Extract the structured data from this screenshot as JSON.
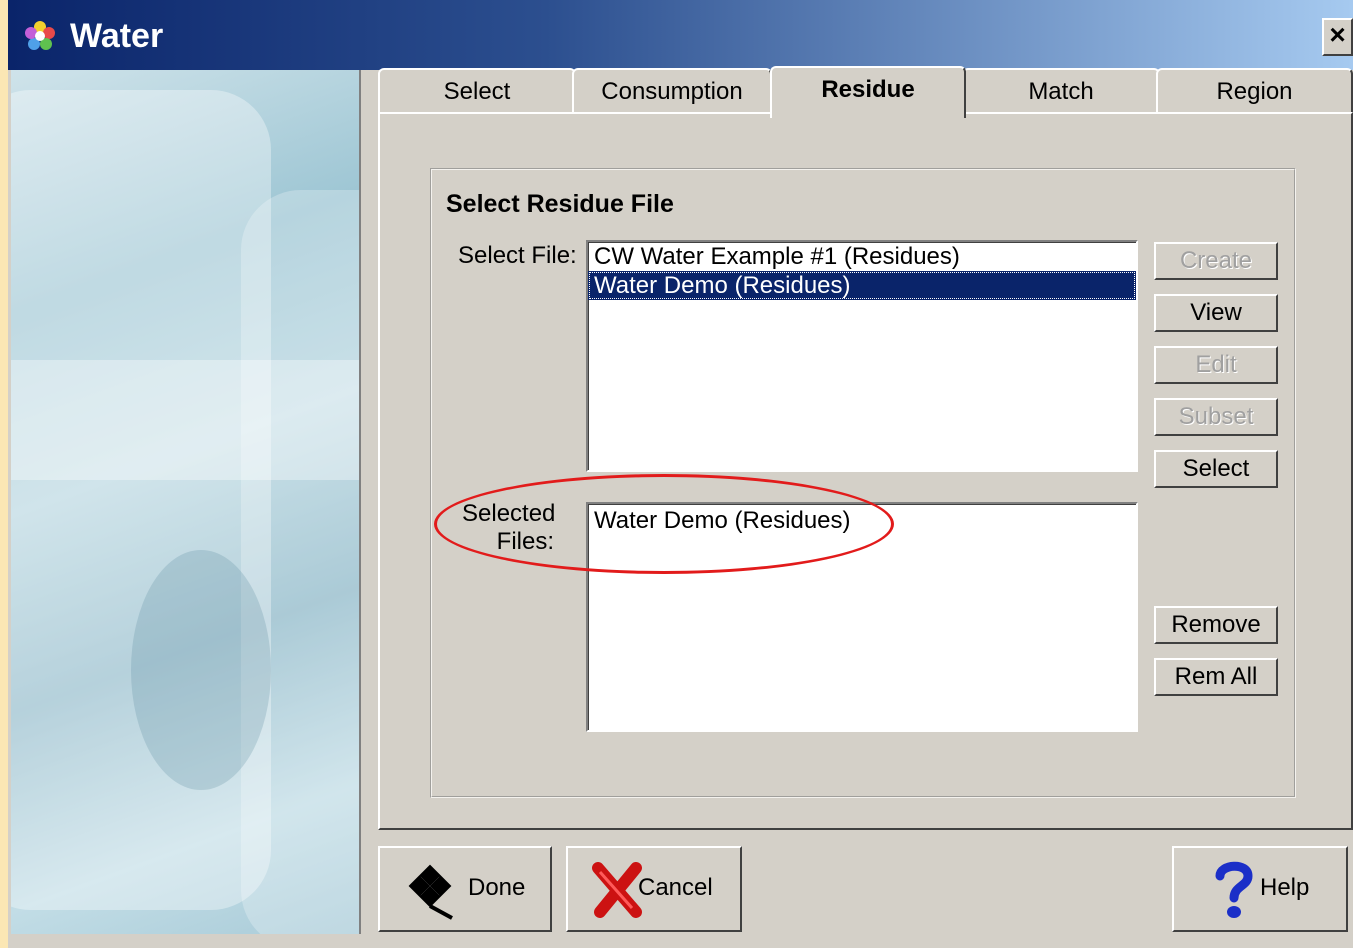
{
  "window": {
    "title": "Water",
    "close_glyph": "×",
    "accent_color": "#0a246a"
  },
  "tabs": [
    {
      "label": "Select",
      "active": false
    },
    {
      "label": "Consumption",
      "active": false
    },
    {
      "label": "Residue",
      "active": true
    },
    {
      "label": "Match",
      "active": false
    },
    {
      "label": "Region",
      "active": false
    }
  ],
  "group": {
    "title": "Select Residue File",
    "select_file_label": "Select File:",
    "selected_files_label_line1": "Selected",
    "selected_files_label_line2": "Files:"
  },
  "file_list": [
    {
      "name": "CW Water Example #1 (Residues)",
      "selected": false
    },
    {
      "name": "Water Demo (Residues)",
      "selected": true
    }
  ],
  "selected_files": [
    "Water Demo (Residues)"
  ],
  "side_buttons": {
    "create": "Create",
    "view": "View",
    "edit": "Edit",
    "subset": "Subset",
    "select": "Select",
    "remove": "Remove",
    "rem_all": "Rem All"
  },
  "footer": {
    "done": "Done",
    "cancel": "Cancel",
    "help": "Help"
  },
  "icons": {
    "app": "flower-icon",
    "done": "checkered-flag-icon",
    "cancel": "red-x-icon",
    "help": "question-mark-icon"
  },
  "highlight_color": "#e21b1b"
}
